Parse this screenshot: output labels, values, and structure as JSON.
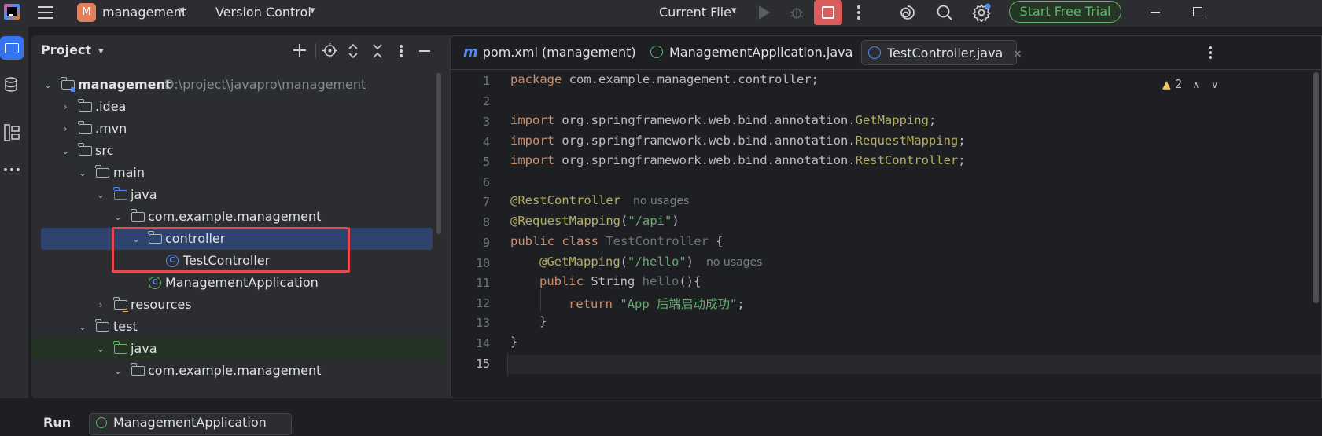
{
  "titlebar": {
    "project_badge": "M",
    "project_name": "management",
    "vcs_label": "Version Control",
    "run_config": "Current File",
    "trial_button": "Start Free Trial"
  },
  "project_panel": {
    "title": "Project",
    "tree": [
      {
        "label": "management",
        "path": "D:\\project\\javapro\\management"
      },
      {
        "label": ".idea"
      },
      {
        "label": ".mvn"
      },
      {
        "label": "src"
      },
      {
        "label": "main"
      },
      {
        "label": "java"
      },
      {
        "label": "com.example.management"
      },
      {
        "label": "controller"
      },
      {
        "label": "TestController"
      },
      {
        "label": "ManagementApplication"
      },
      {
        "label": "resources"
      },
      {
        "label": "test"
      },
      {
        "label": "java"
      },
      {
        "label": "com.example.management"
      }
    ]
  },
  "editor": {
    "tabs": [
      {
        "label": "pom.xml (management)"
      },
      {
        "label": "ManagementApplication.java"
      },
      {
        "label": "TestController.java"
      }
    ],
    "active_tab": "TestController.java",
    "warnings_count": "2",
    "line_numbers": [
      "1",
      "2",
      "3",
      "4",
      "5",
      "6",
      "7",
      "8",
      "9",
      "10",
      "11",
      "12",
      "13",
      "14",
      "15"
    ],
    "code": {
      "l1_kw": "package",
      "l1_rest": " com.example.management.controller;",
      "l3_kw": "import",
      "l3_pkg": " org.springframework.web.bind.annotation.",
      "l3_cls": "GetMapping",
      "l4_kw": "import",
      "l4_pkg": " org.springframework.web.bind.annotation.",
      "l4_cls": "RequestMapping",
      "l5_kw": "import",
      "l5_pkg": " org.springframework.web.bind.annotation.",
      "l5_cls": "RestController",
      "semi": ";",
      "l7_ann": "@RestController",
      "l7_hint": "no usages",
      "l8_ann": "@RequestMapping",
      "l8_open": "(",
      "l8_str": "\"/api\"",
      "l8_close": ")",
      "l9_kw": "public class",
      "l9_name": " TestController",
      "l9_brace": " {",
      "l10_ann": "@GetMapping",
      "l10_open": "(",
      "l10_str": "\"/hello\"",
      "l10_close": ")",
      "l10_hint": "no usages",
      "l11_kw": "public",
      "l11_type": " String ",
      "l11_name": "hello",
      "l11_rest": "(){",
      "l12_kw": "return",
      "l12_str": " \"App 后端启动成功\"",
      "l12_semi": ";",
      "l13": "}",
      "l14": "}"
    }
  },
  "bottom": {
    "run_label": "Run",
    "run_tab": "ManagementApplication"
  },
  "colors": {
    "accent": "#548af7",
    "selection": "#2e436e",
    "highlight_box": "#e5484d",
    "stop_button": "#db5c5c",
    "trial_green": "#5fb865"
  }
}
